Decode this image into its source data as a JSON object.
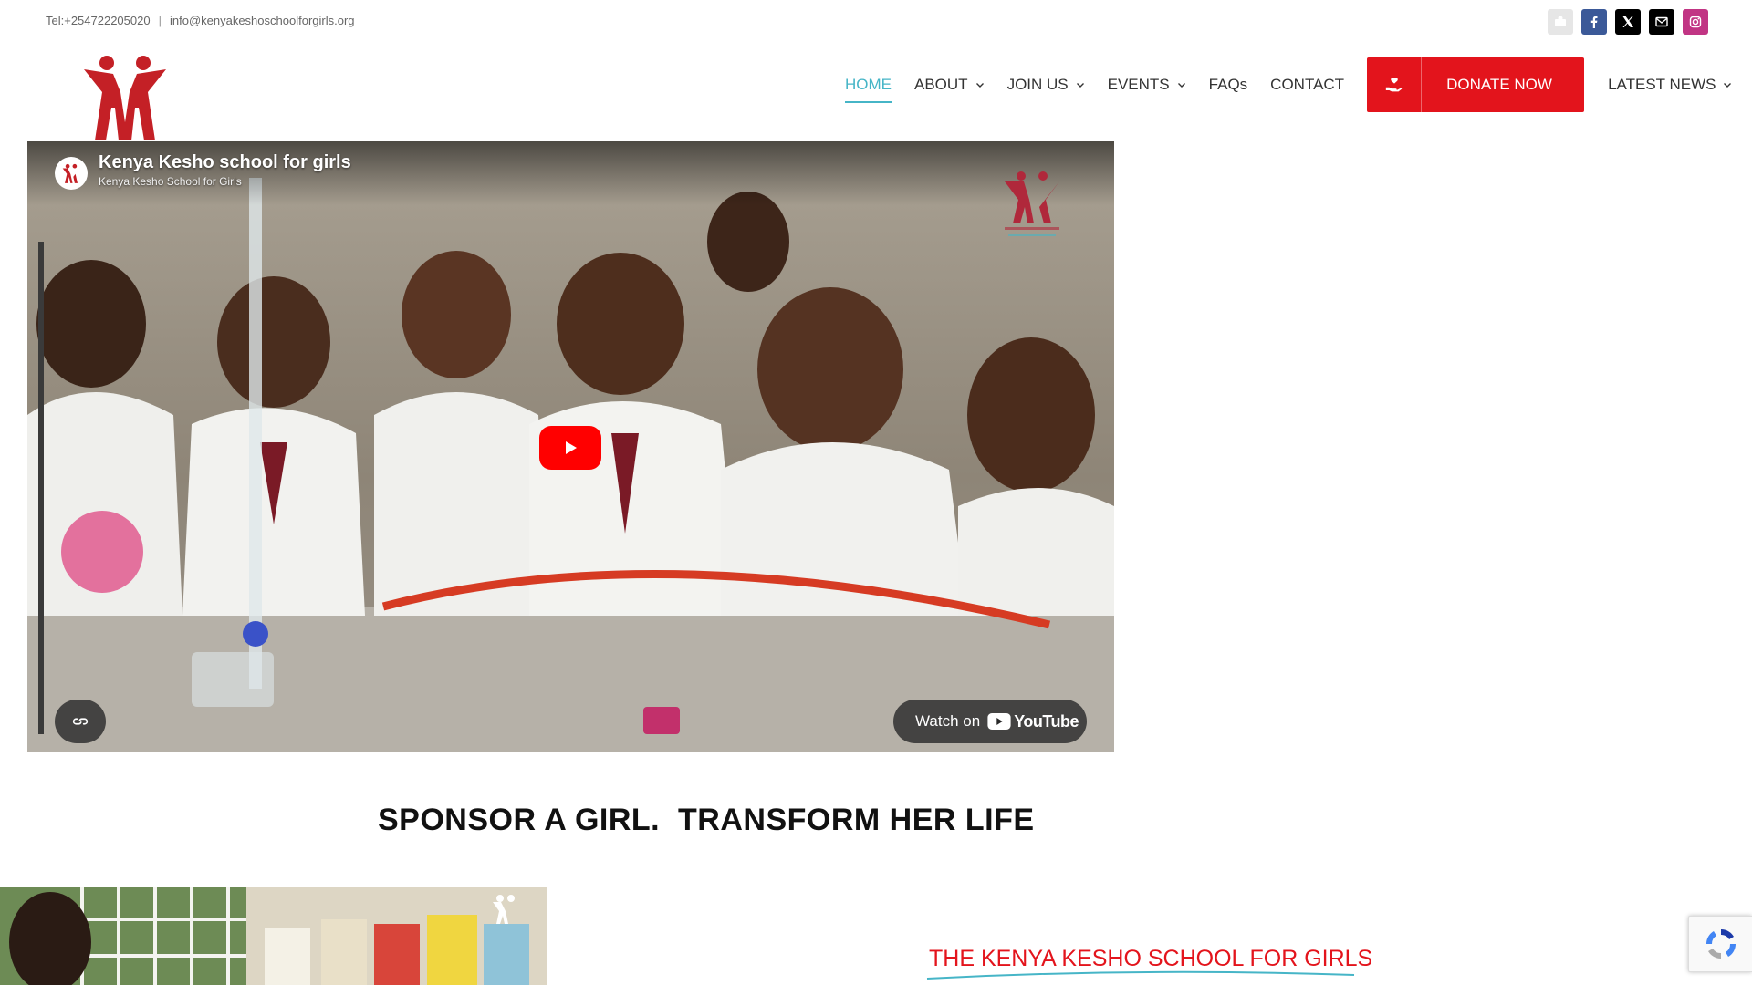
{
  "topbar": {
    "phone": "Tel:+254722205020",
    "separator": "|",
    "email": "info@kenyakeshoschoolforgirls.org",
    "social": [
      {
        "name": "mail-alt-icon",
        "color": "#e6e6e6"
      },
      {
        "name": "facebook-icon",
        "color": "#3b5998"
      },
      {
        "name": "x-twitter-icon",
        "color": "#000000"
      },
      {
        "name": "email-icon",
        "color": "#000000"
      },
      {
        "name": "instagram-icon",
        "color": "#c13584"
      }
    ]
  },
  "nav": {
    "items": [
      {
        "label": "HOME",
        "active": true,
        "dropdown": false
      },
      {
        "label": "ABOUT",
        "active": false,
        "dropdown": true
      },
      {
        "label": "JOIN US",
        "active": false,
        "dropdown": true
      },
      {
        "label": "EVENTS",
        "active": false,
        "dropdown": true
      },
      {
        "label": "FAQs",
        "active": false,
        "dropdown": false
      },
      {
        "label": "CONTACT",
        "active": false,
        "dropdown": false
      }
    ],
    "donate_label": "DONATE NOW",
    "latest_news_label": "LATEST NEWS",
    "accent": "#46b5c7",
    "donate_color": "#e3141c"
  },
  "video": {
    "title": "Kenya Kesho school for girls",
    "channel": "Kenya Kesho School for Girls",
    "watch_on": "Watch on",
    "youtube": "YouTube"
  },
  "headline": "SPONSOR A GIRL.  TRANSFORM HER LIFE",
  "section": {
    "title": "THE KENYA KESHO SCHOOL FOR GIRLS"
  }
}
